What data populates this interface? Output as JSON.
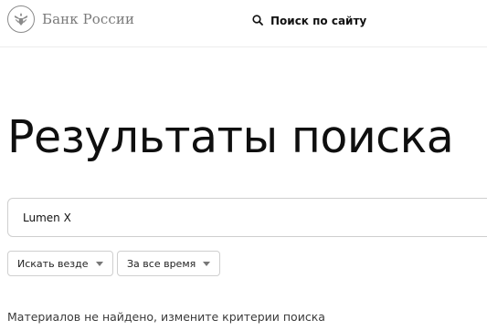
{
  "header": {
    "logo_text": "Банк России",
    "logo_icon": "double-headed-eagle-emblem",
    "site_search_label": "Поиск по сайту",
    "site_search_icon": "search-icon"
  },
  "page": {
    "title": "Результаты поиска"
  },
  "search": {
    "value": "Lumen X"
  },
  "filters": {
    "scope_selected": "Искать везде",
    "period_selected": "За все время",
    "dropdown_icon": "caret-down-icon"
  },
  "results": {
    "empty_message": "Материалов не найдено, измените критерии поиска"
  }
}
